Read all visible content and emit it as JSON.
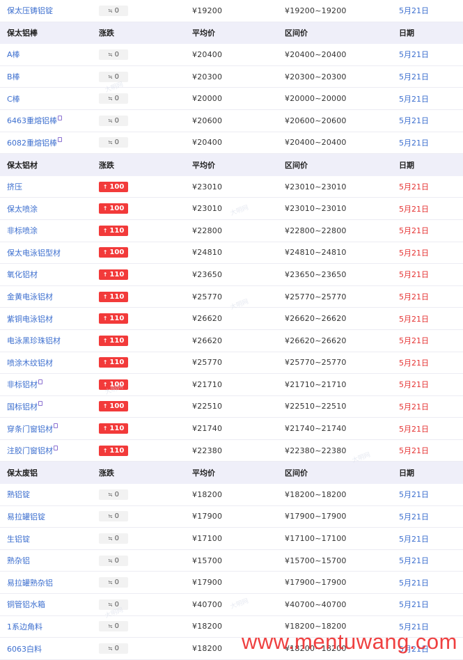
{
  "columns": {
    "change": "涨跌",
    "avg": "平均价",
    "range": "区间价",
    "date": "日期"
  },
  "currency": "¥",
  "range_sep": "~",
  "change_icons": {
    "flat": "≒",
    "up": "↑"
  },
  "colors": {
    "link": "#3d6fcf",
    "up_red": "#f23a3a",
    "header_bg": "#efeff9"
  },
  "top_row": {
    "name": "保太压铸铝锭",
    "change": "0",
    "dir": "flat",
    "avg": "19200",
    "low": "19200",
    "high": "19200",
    "date": "5月21日"
  },
  "sections": [
    {
      "title": "保太铝棒",
      "rows": [
        {
          "name": "A棒",
          "change": "0",
          "dir": "flat",
          "avg": "20400",
          "low": "20400",
          "high": "20400",
          "date": "5月21日"
        },
        {
          "name": "B棒",
          "change": "0",
          "dir": "flat",
          "avg": "20300",
          "low": "20300",
          "high": "20300",
          "date": "5月21日"
        },
        {
          "name": "C棒",
          "change": "0",
          "dir": "flat",
          "avg": "20000",
          "low": "20000",
          "high": "20000",
          "date": "5月21日"
        },
        {
          "name": "6463重熔铝棒",
          "change": "0",
          "dir": "flat",
          "avg": "20600",
          "low": "20600",
          "high": "20600",
          "date": "5月21日",
          "pin": true
        },
        {
          "name": "6082重熔铝棒",
          "change": "0",
          "dir": "flat",
          "avg": "20400",
          "low": "20400",
          "high": "20400",
          "date": "5月21日",
          "pin": true
        }
      ]
    },
    {
      "title": "保太铝材",
      "rows": [
        {
          "name": "挤压",
          "change": "100",
          "dir": "up",
          "avg": "23010",
          "low": "23010",
          "high": "23010",
          "date": "5月21日"
        },
        {
          "name": "保太喷涂",
          "change": "100",
          "dir": "up",
          "avg": "23010",
          "low": "23010",
          "high": "23010",
          "date": "5月21日"
        },
        {
          "name": "非标喷涂",
          "change": "110",
          "dir": "up",
          "avg": "22800",
          "low": "22800",
          "high": "22800",
          "date": "5月21日"
        },
        {
          "name": "保太电泳铝型材",
          "change": "100",
          "dir": "up",
          "avg": "24810",
          "low": "24810",
          "high": "24810",
          "date": "5月21日"
        },
        {
          "name": "氧化铝材",
          "change": "110",
          "dir": "up",
          "avg": "23650",
          "low": "23650",
          "high": "23650",
          "date": "5月21日"
        },
        {
          "name": "金黄电泳铝材",
          "change": "110",
          "dir": "up",
          "avg": "25770",
          "low": "25770",
          "high": "25770",
          "date": "5月21日"
        },
        {
          "name": "紫铜电泳铝材",
          "change": "110",
          "dir": "up",
          "avg": "26620",
          "low": "26620",
          "high": "26620",
          "date": "5月21日"
        },
        {
          "name": "电泳黑珍珠铝材",
          "change": "110",
          "dir": "up",
          "avg": "26620",
          "low": "26620",
          "high": "26620",
          "date": "5月21日"
        },
        {
          "name": "喷涂木纹铝材",
          "change": "110",
          "dir": "up",
          "avg": "25770",
          "low": "25770",
          "high": "25770",
          "date": "5月21日"
        },
        {
          "name": "非标铝材",
          "change": "100",
          "dir": "up",
          "avg": "21710",
          "low": "21710",
          "high": "21710",
          "date": "5月21日",
          "pin": true
        },
        {
          "name": "国标铝材",
          "change": "100",
          "dir": "up",
          "avg": "22510",
          "low": "22510",
          "high": "22510",
          "date": "5月21日",
          "pin": true
        },
        {
          "name": "穿条门窗铝材",
          "change": "110",
          "dir": "up",
          "avg": "21740",
          "low": "21740",
          "high": "21740",
          "date": "5月21日",
          "pin": true
        },
        {
          "name": "注胶门窗铝材",
          "change": "110",
          "dir": "up",
          "avg": "22380",
          "low": "22380",
          "high": "22380",
          "date": "5月21日",
          "pin": true
        }
      ]
    },
    {
      "title": "保太废铝",
      "rows": [
        {
          "name": "熟铝锭",
          "change": "0",
          "dir": "flat",
          "avg": "18200",
          "low": "18200",
          "high": "18200",
          "date": "5月21日"
        },
        {
          "name": "易拉罐铝锭",
          "change": "0",
          "dir": "flat",
          "avg": "17900",
          "low": "17900",
          "high": "17900",
          "date": "5月21日"
        },
        {
          "name": "生铝锭",
          "change": "0",
          "dir": "flat",
          "avg": "17100",
          "low": "17100",
          "high": "17100",
          "date": "5月21日"
        },
        {
          "name": "熟杂铝",
          "change": "0",
          "dir": "flat",
          "avg": "15700",
          "low": "15700",
          "high": "15700",
          "date": "5月21日"
        },
        {
          "name": "易拉罐熟杂铝",
          "change": "0",
          "dir": "flat",
          "avg": "17900",
          "low": "17900",
          "high": "17900",
          "date": "5月21日"
        },
        {
          "name": "铜管铝水箱",
          "change": "0",
          "dir": "flat",
          "avg": "40700",
          "low": "40700",
          "high": "40700",
          "date": "5月21日"
        },
        {
          "name": "1系边角料",
          "change": "0",
          "dir": "flat",
          "avg": "18200",
          "low": "18200",
          "high": "18200",
          "date": "5月21日"
        },
        {
          "name": "6063白料",
          "change": "0",
          "dir": "flat",
          "avg": "18200",
          "low": "18200",
          "high": "18200",
          "date": "5月21日"
        }
      ]
    }
  ],
  "watermarks": {
    "faint": "大明网",
    "site": "www.mentuwang.com"
  }
}
